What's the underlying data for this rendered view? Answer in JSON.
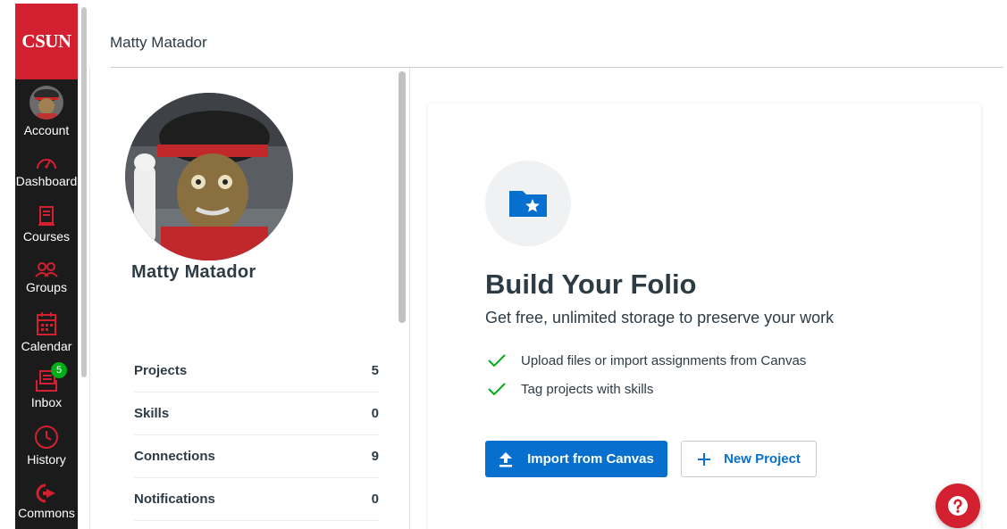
{
  "global_nav": {
    "logo": "CSUN",
    "items": [
      {
        "label": "Account",
        "icon": "avatar"
      },
      {
        "label": "Dashboard",
        "icon": "dashboard-icon"
      },
      {
        "label": "Courses",
        "icon": "courses-icon"
      },
      {
        "label": "Groups",
        "icon": "groups-icon"
      },
      {
        "label": "Calendar",
        "icon": "calendar-icon"
      },
      {
        "label": "Inbox",
        "icon": "inbox-icon",
        "badge": "5"
      },
      {
        "label": "History",
        "icon": "history-icon"
      },
      {
        "label": "Commons",
        "icon": "commons-icon"
      }
    ]
  },
  "breadcrumb": {
    "user": "Matty Matador"
  },
  "profile": {
    "name": "Matty Matador",
    "stats": [
      {
        "label": "Projects",
        "value": "5"
      },
      {
        "label": "Skills",
        "value": "0"
      },
      {
        "label": "Connections",
        "value": "9"
      },
      {
        "label": "Notifications",
        "value": "0"
      }
    ]
  },
  "main": {
    "title": "Build Your Folio",
    "subtitle": "Get free, unlimited storage to preserve your work",
    "features": [
      "Upload files or import assignments from Canvas",
      "Tag projects with skills"
    ],
    "import_button": "Import from Canvas",
    "new_project_button": "New Project"
  },
  "colors": {
    "brand_red": "#d22030",
    "nav_bg": "#1b1b1b",
    "primary_blue": "#0770cf",
    "check_green": "#00ac18",
    "badge_green": "#00ac18"
  }
}
